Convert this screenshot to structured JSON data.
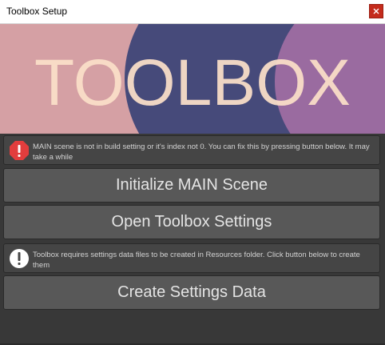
{
  "window": {
    "title": "Toolbox Setup"
  },
  "banner": {
    "logo_text": "TOOLBOX",
    "colors": {
      "background": "#d5a0a4",
      "circle_navy": "#464a7a",
      "circle_purple": "#9a6ba0",
      "text": "#fbe0c8"
    }
  },
  "messages": {
    "main_scene": "MAIN scene is not in build setting or it's index not 0. You can fix this by pressing button below. It may take a while",
    "settings_data": "Toolbox requires settings data files to be created in Resources folder. Click button below to create them"
  },
  "buttons": {
    "initialize_main_scene": "Initialize MAIN Scene",
    "open_toolbox_settings": "Open Toolbox Settings",
    "create_settings_data": "Create Settings Data"
  },
  "icons": {
    "error": "error-icon",
    "info": "info-icon",
    "close": "close-icon"
  }
}
